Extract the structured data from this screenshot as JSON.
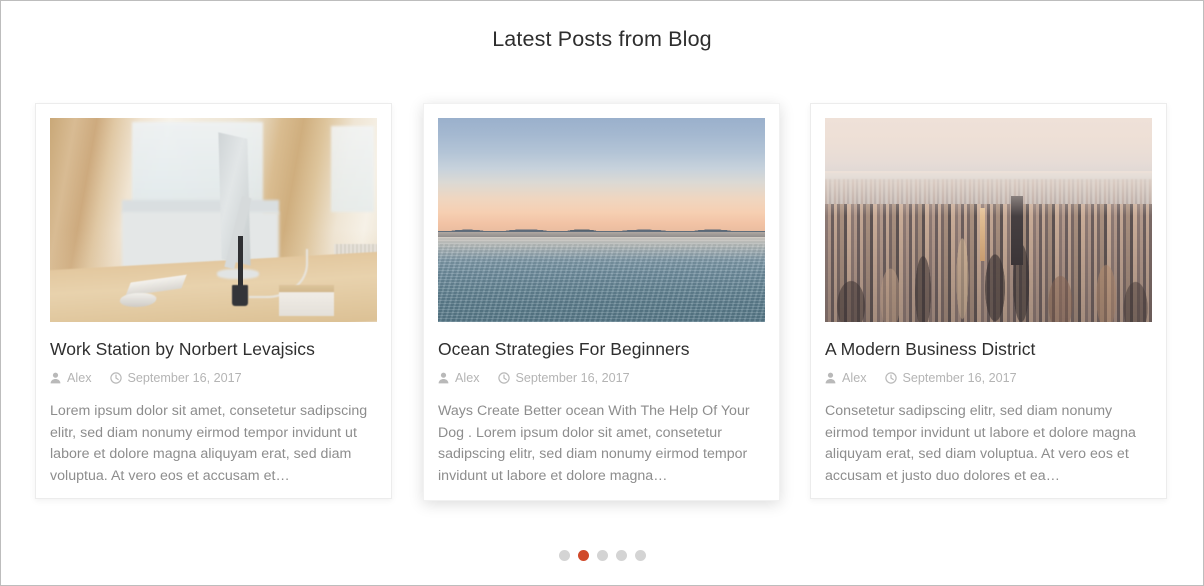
{
  "section": {
    "title": "Latest Posts from Blog"
  },
  "posts": [
    {
      "title": "Work Station by Norbert Levajsics",
      "author": "Alex",
      "date": "September 16, 2017",
      "excerpt": "Lorem ipsum dolor sit amet, consetetur sadipscing elitr, sed diam nonumy eirmod tempor invidunt ut labore et dolore magna aliquyam erat, sed diam voluptua. At vero eos et accusam et…",
      "image_alt": "workstation-photo",
      "featured": false
    },
    {
      "title": "Ocean Strategies For Beginners",
      "author": "Alex",
      "date": "September 16, 2017",
      "excerpt": "Ways Create Better ocean With The Help Of Your Dog . Lorem ipsum dolor sit amet, consetetur sadipscing elitr, sed diam nonumy eirmod tempor invidunt ut labore et dolore magna…",
      "image_alt": "ocean-sunset-photo",
      "featured": true
    },
    {
      "title": "A Modern Business District",
      "author": "Alex",
      "date": "September 16, 2017",
      "excerpt": "Consetetur sadipscing elitr, sed diam nonumy eirmod tempor invidunt ut labore et dolore magna aliquyam erat, sed diam voluptua. At vero eos et accusam et justo duo dolores et ea…",
      "image_alt": "city-skyline-photo",
      "featured": false
    }
  ],
  "icons": {
    "author": "user-icon",
    "date": "clock-icon"
  },
  "pagination": {
    "total": 5,
    "active_index": 1,
    "dots": [
      "1",
      "2",
      "3",
      "4",
      "5"
    ]
  },
  "colors": {
    "accent": "#d0492a",
    "dot_inactive": "#d4d4d4",
    "title_text": "#2e2e2e",
    "body_text": "#8d8d8d",
    "meta_text": "#b4b4b4",
    "card_background": "#ffffff",
    "page_background": "#ffffff"
  }
}
